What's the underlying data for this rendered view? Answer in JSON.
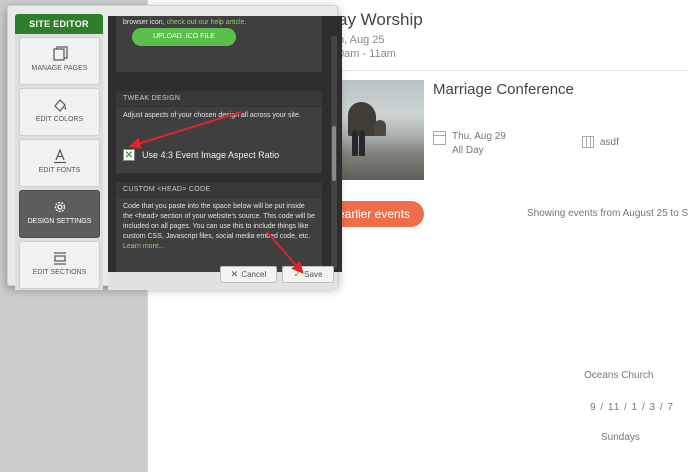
{
  "editor": {
    "tab_label": "SITE EDITOR",
    "nav": [
      {
        "label": "MANAGE PAGES",
        "icon": "pages-icon"
      },
      {
        "label": "EDIT COLORS",
        "icon": "paint-bucket-icon"
      },
      {
        "label": "EDIT FONTS",
        "icon": "font-icon"
      },
      {
        "label": "DESIGN SETTINGS",
        "icon": "gear-icon",
        "active": true
      },
      {
        "label": "EDIT SECTIONS",
        "icon": "sections-icon"
      }
    ],
    "favicon": {
      "text": "browser icon,",
      "link": "check out our help article.",
      "upload_label": "UPLOAD .ICO FILE"
    },
    "tweak": {
      "heading": "TWEAK DESIGN",
      "desc": "Adjust aspects of your chosen design all across your site.",
      "checkbox_label": "Use 4:3 Event Image Aspect Ratio",
      "checked": true
    },
    "custom_head": {
      "heading": "CUSTOM <HEAD> CODE",
      "desc": "Code that you paste into the space below will be put inside the <head> section of your website's source. This code will be included on all pages. You can use this to include things like custom CSS, Javascript files, social media embed code, etc.",
      "link": "Learn more..."
    },
    "cancel_label": "Cancel",
    "save_label": "Save"
  },
  "events": {
    "top_title": "ay Worship",
    "top_date": "n, Aug 25",
    "top_time": "0am - 11am",
    "conf_title": "Marriage Conference",
    "conf_date": "Thu, Aug 29",
    "conf_allday": "All Day",
    "conf_location": "asdf",
    "earlier_label": "earlier events",
    "showing_text": "Showing events from August 25 to S"
  },
  "footer": {
    "church": "Oceans Church",
    "times": "9 / 11 / 1 / 3 / 7",
    "days": "Sundays"
  },
  "colors": {
    "accent_green": "#5bbf4c",
    "tab_green": "#2f7e2a",
    "orange": "#ef6e4a",
    "arrow_red": "#e0242c"
  }
}
